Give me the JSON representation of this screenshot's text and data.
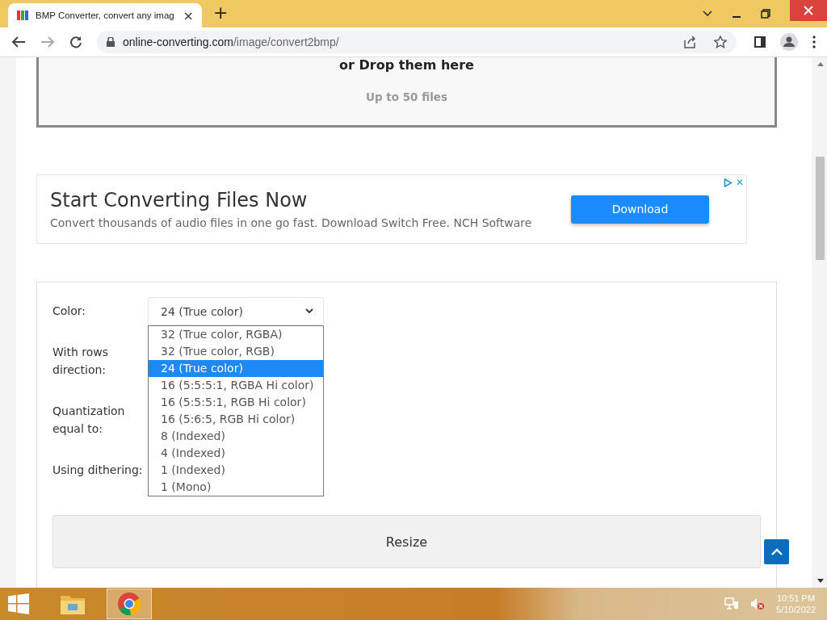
{
  "browser": {
    "tab_title": "BMP Converter, convert any imag",
    "tab_close": "×",
    "new_tab": "+",
    "url_domain": "online-converting.com",
    "url_path": "/image/convert2bmp/"
  },
  "drop_zone": {
    "title": "or Drop them here",
    "note": "Up to 50 files"
  },
  "ad": {
    "title": "Start Converting Files Now",
    "text": "Convert thousands of audio files in one go fast. Download Switch Free. NCH Software",
    "button": "Download",
    "close": "✕"
  },
  "options": {
    "labels": [
      "Color:",
      "With rows direction:",
      "Quantization equal to:",
      "Using dithering:"
    ],
    "color_select": {
      "value": "24 (True color)",
      "expanded": true,
      "options": [
        {
          "label": "32 (True color, RGBA)",
          "selected": false
        },
        {
          "label": "32 (True color, RGB)",
          "selected": false
        },
        {
          "label": "24 (True color)",
          "selected": true
        },
        {
          "label": "16 (5:5:5:1, RGBA Hi color)",
          "selected": false
        },
        {
          "label": "16 (5:5:5:1, RGB Hi color)",
          "selected": false
        },
        {
          "label": "16 (5:6:5, RGB Hi color)",
          "selected": false
        },
        {
          "label": "8 (Indexed)",
          "selected": false
        },
        {
          "label": "4 (Indexed)",
          "selected": false
        },
        {
          "label": "1 (Indexed)",
          "selected": false
        },
        {
          "label": "1 (Mono)",
          "selected": false
        }
      ]
    },
    "resize_button": "Resize"
  },
  "taskbar": {
    "time": "10:51 PM",
    "date": "5/10/2022"
  }
}
